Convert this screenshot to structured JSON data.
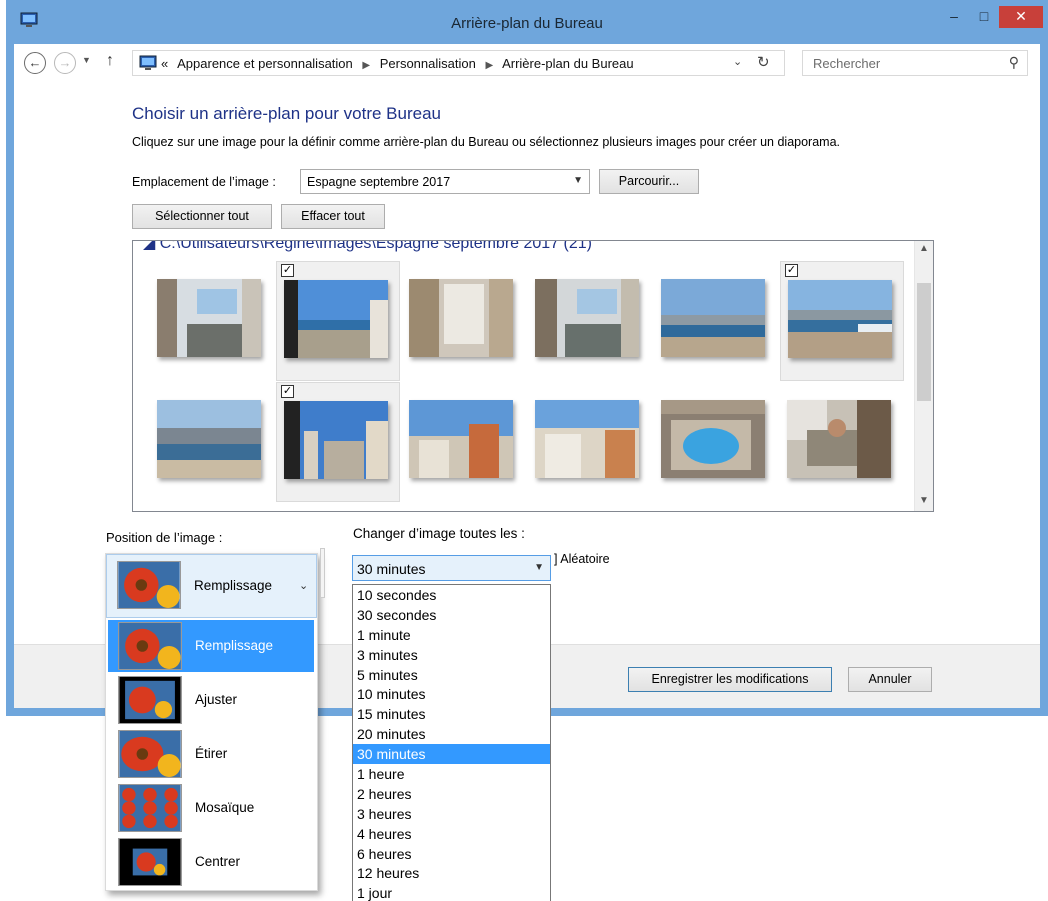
{
  "window": {
    "title": "Arrière-plan du Bureau",
    "controls": {
      "minimize": "–",
      "maximize": "□",
      "close": "✕"
    }
  },
  "nav": {
    "breadcrumb_prefix": "«",
    "breadcrumb": [
      "Apparence et personnalisation",
      "Personnalisation",
      "Arrière-plan du Bureau"
    ],
    "search_placeholder": "Rechercher"
  },
  "main": {
    "heading": "Choisir un arrière-plan pour votre Bureau",
    "description": "Cliquez sur une image pour la définir comme arrière-plan du Bureau ou sélectionnez plusieurs images pour créer un diaporama.",
    "location_label": "Emplacement de l’image :",
    "location_value": "Espagne septembre 2017",
    "browse_button": "Parcourir...",
    "select_all_button": "Sélectionner tout",
    "clear_all_button": "Effacer tout",
    "folder_path": "C:\\Utilisateurs\\Régine\\Images\\Espagne septembre 2017 (21)"
  },
  "images": [
    {
      "id": "balcony-1",
      "checked": false
    },
    {
      "id": "balcony-sea-view",
      "checked": true
    },
    {
      "id": "curtains-room",
      "checked": false
    },
    {
      "id": "balcony-2",
      "checked": false
    },
    {
      "id": "beach-1",
      "checked": false
    },
    {
      "id": "beach-2",
      "checked": true
    },
    {
      "id": "coast-mountains",
      "checked": false
    },
    {
      "id": "city-view",
      "checked": true
    },
    {
      "id": "buildings-1",
      "checked": false
    },
    {
      "id": "buildings-2",
      "checked": false
    },
    {
      "id": "pool",
      "checked": false
    },
    {
      "id": "man-lounging",
      "checked": false
    }
  ],
  "position": {
    "label": "Position de l’image :",
    "selected": "Remplissage",
    "options": [
      "Remplissage",
      "Ajuster",
      "Étirer",
      "Mosaïque",
      "Centrer"
    ]
  },
  "interval": {
    "label": "Changer d’image toutes les :",
    "selected": "30 minutes",
    "shuffle_label": "Aléatoire",
    "options": [
      "10 secondes",
      "30 secondes",
      "1 minute",
      "3 minutes",
      "5 minutes",
      "10 minutes",
      "15 minutes",
      "20 minutes",
      "30 minutes",
      "1 heure",
      "2 heures",
      "3 heures",
      "4 heures",
      "6 heures",
      "12 heures",
      "1 jour"
    ]
  },
  "footer": {
    "save_button": "Enregistrer les modifications",
    "cancel_button": "Annuler"
  },
  "colors": {
    "titlebar": "#6fa6dc",
    "heading": "#1e3287",
    "selection": "#3399ff",
    "close": "#c8403a"
  }
}
